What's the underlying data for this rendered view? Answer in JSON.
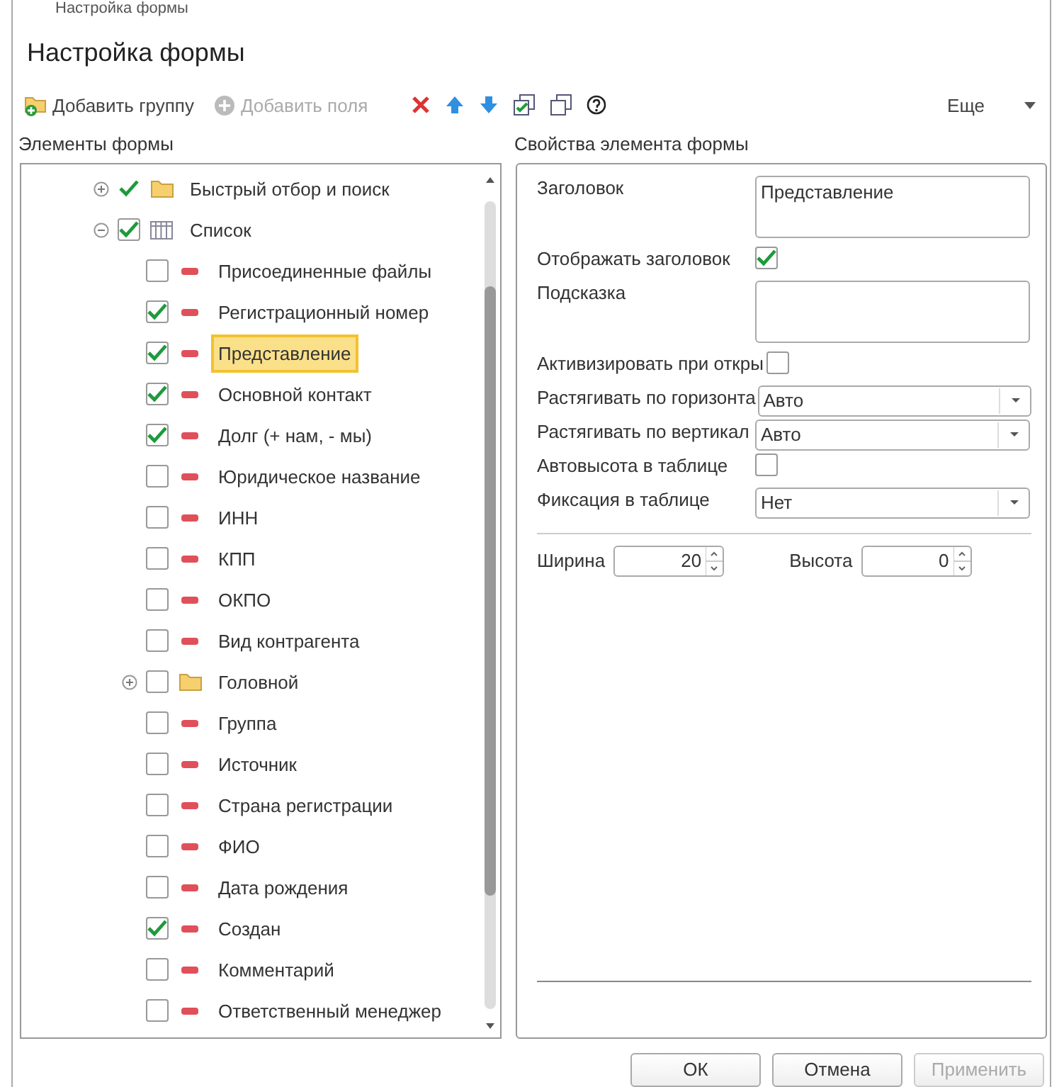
{
  "window": {
    "title": "Настройка формы"
  },
  "heading": "Настройка формы",
  "toolbar": {
    "items": [
      {
        "kind": "add-group",
        "label": "Добавить группу",
        "disabled": false
      },
      {
        "kind": "add-fields",
        "label": "Добавить поля",
        "disabled": true
      }
    ],
    "more": "Еще"
  },
  "left_title": "Элементы формы",
  "right_title": "Свойства элемента формы",
  "tree": [
    {
      "label": "Быстрый отбор и поиск",
      "kind": "folder",
      "boxed": false,
      "checked": true,
      "expanded": false,
      "selected": false
    },
    {
      "label": "Список",
      "kind": "table",
      "checked": true,
      "expanded": true,
      "selected": false,
      "children": [
        {
          "label": "Присоединенные файлы",
          "kind": "field",
          "checked": false,
          "selected": false
        },
        {
          "label": "Регистрационный номер",
          "kind": "field",
          "checked": true,
          "selected": false
        },
        {
          "label": "Представление",
          "kind": "field",
          "checked": true,
          "selected": true
        },
        {
          "label": "Основной контакт",
          "kind": "field",
          "checked": true,
          "selected": false
        },
        {
          "label": "Долг (+ нам, - мы)",
          "kind": "field",
          "checked": true,
          "selected": false
        },
        {
          "label": "Юридическое название",
          "kind": "field",
          "checked": false,
          "selected": false
        },
        {
          "label": "ИНН",
          "kind": "field",
          "checked": false,
          "selected": false
        },
        {
          "label": "КПП",
          "kind": "field",
          "checked": false,
          "selected": false
        },
        {
          "label": "ОКПО",
          "kind": "field",
          "checked": false,
          "selected": false
        },
        {
          "label": "Вид контрагента",
          "kind": "field",
          "checked": false,
          "selected": false
        },
        {
          "label": "Головной",
          "kind": "folder",
          "checked": false,
          "expanded": false,
          "selected": false
        },
        {
          "label": "Группа",
          "kind": "field",
          "checked": false,
          "selected": false
        },
        {
          "label": "Источник",
          "kind": "field",
          "checked": false,
          "selected": false
        },
        {
          "label": "Страна регистрации",
          "kind": "field",
          "checked": false,
          "selected": false
        },
        {
          "label": "ФИО",
          "kind": "field",
          "checked": false,
          "selected": false
        },
        {
          "label": "Дата рождения",
          "kind": "field",
          "checked": false,
          "selected": false
        },
        {
          "label": "Создан",
          "kind": "field",
          "checked": true,
          "selected": false
        },
        {
          "label": "Комментарий",
          "kind": "field",
          "checked": false,
          "selected": false
        },
        {
          "label": "Ответственный менеджер",
          "kind": "field",
          "checked": false,
          "selected": false
        }
      ]
    }
  ],
  "properties": [
    {
      "kind": "textarea",
      "label": "Заголовок",
      "value": "Представление"
    },
    {
      "kind": "checkbox",
      "label": "Отображать заголовок",
      "checked": true
    },
    {
      "kind": "textarea",
      "label": "Подсказка"
    },
    {
      "kind": "checkbox",
      "label": "Активизировать при откры",
      "checked": false
    },
    {
      "kind": "select",
      "label": "Растягивать по горизонта",
      "value": "Авто"
    },
    {
      "kind": "select",
      "label": "Растягивать по вертикал",
      "value": "Авто"
    },
    {
      "kind": "checkbox",
      "label": "Автовысота в таблице",
      "checked": false
    },
    {
      "kind": "select",
      "label": "Фиксация в таблице",
      "value": "Нет"
    }
  ],
  "size": [
    {
      "label": "Ширина",
      "value": "20"
    },
    {
      "label": "Высота",
      "value": "0"
    }
  ],
  "buttons": [
    {
      "label": "ОК",
      "disabled": false
    },
    {
      "label": "Отмена",
      "disabled": false
    },
    {
      "label": "Применить",
      "disabled": true
    }
  ]
}
